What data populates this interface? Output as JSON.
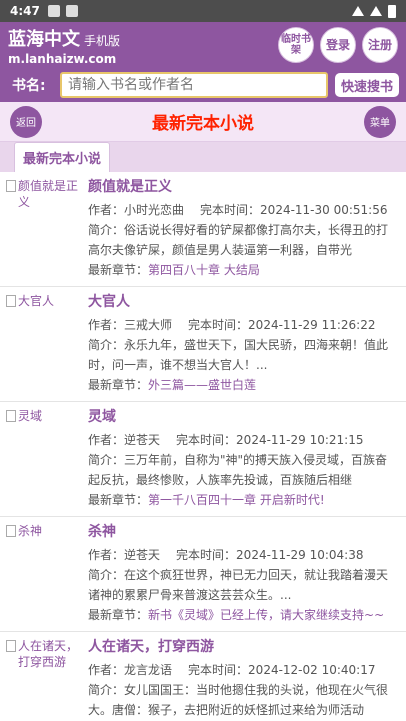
{
  "status": {
    "time": "4:47"
  },
  "header": {
    "brand_title": "蓝海中文",
    "brand_sub": "手机版",
    "brand_url": "m.lanhaizw.com",
    "btn_shelf": "临时书架",
    "btn_login": "登录",
    "btn_register": "注册"
  },
  "search": {
    "label": "书名:",
    "placeholder": "请输入书名或作者名",
    "button": "快速搜书"
  },
  "titlebar": {
    "back": "返回",
    "title": "最新完本小说",
    "menu": "菜单"
  },
  "tab": {
    "label": "最新完本小说"
  },
  "labels": {
    "author": "作者：",
    "finish_time": "完本时间：",
    "intro": "简介：",
    "latest": "最新章节："
  },
  "books": [
    {
      "cover_alt": "颜值就是正义",
      "name": "颜值就是正义",
      "author": "小时光恋曲",
      "time": "2024-11-30 00:51:56",
      "intro": "俗话说长得好看的铲屎都像打高尔夫，长得丑的打高尔夫像铲屎，颜值是男人装逼第一利器，自带光",
      "latest": "第四百八十章 大结局"
    },
    {
      "cover_alt": "大官人",
      "name": "大官人",
      "author": "三戒大师",
      "time": "2024-11-29 11:26:22",
      "intro": "永乐九年，盛世天下，国大民骄，四海来朝！值此时，问一声，谁不想当大官人！...",
      "latest": "外三篇——盛世白莲"
    },
    {
      "cover_alt": "灵域",
      "name": "灵域",
      "author": "逆苍天",
      "time": "2024-11-29 10:21:15",
      "intro": "三万年前，自称为\"神\"的搏天族入侵灵域，百族奋起反抗，最终惨败，人族率先投诚，百族随后相继",
      "latest": "第一千八百四十一章 开启新时代!"
    },
    {
      "cover_alt": "杀神",
      "name": "杀神",
      "author": "逆苍天",
      "time": "2024-11-29 10:04:38",
      "intro": "在这个疯狂世界，神已无力回天，就让我踏着漫天诸神的累累尸骨来普渡这芸芸众生。...",
      "latest": "新书《灵域》已经上传，请大家继续支持~~"
    },
    {
      "cover_alt": "人在诸天，打穿西游",
      "name": "人在诸天，打穿西游",
      "author": "龙言龙语",
      "time": "2024-12-02 10:40:17",
      "intro": "女儿国国王：当时他摁住我的头说，他现在火气很大。唐僧：猴子，去把附近的妖怪抓过来给为师活动",
      "latest": ""
    }
  ]
}
